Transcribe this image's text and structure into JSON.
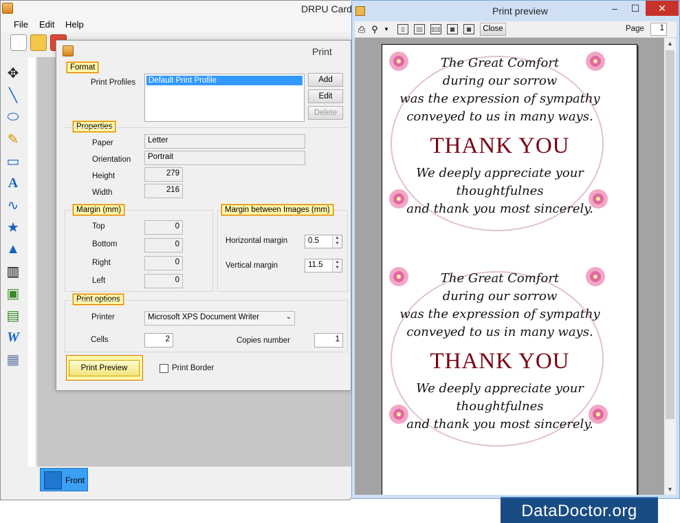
{
  "app": {
    "title": "DRPU Card",
    "menu": [
      "File",
      "Edit",
      "Help"
    ],
    "bottom_tab": "Front"
  },
  "print_dialog": {
    "title": "Print",
    "format_label": "Format",
    "profiles_label": "Print Profiles",
    "profiles": [
      "Default Print Profile"
    ],
    "add_label": "Add",
    "edit_label": "Edit",
    "delete_label": "Delete",
    "properties_label": "Properties",
    "paper_label": "Paper",
    "paper_value": "Letter",
    "orientation_label": "Orientation",
    "orientation_value": "Portrait",
    "height_label": "Height",
    "height_value": "279",
    "width_label": "Width",
    "width_value": "216",
    "margin_label": "Margin (mm)",
    "top_label": "Top",
    "top_value": "0",
    "bottom_label": "Bottom",
    "bottom_value": "0",
    "right_label": "Right",
    "right_value": "0",
    "left_label": "Left",
    "left_value": "0",
    "margin_images_label": "Margin between Images (mm)",
    "hmargin_label": "Horizontal margin",
    "hmargin_value": "0.5",
    "vmargin_label": "Vertical margin",
    "vmargin_value": "11.5",
    "print_options_label": "Print options",
    "printer_label": "Printer",
    "printer_value": "Microsoft XPS Document Writer",
    "cells_label": "Cells",
    "cells_value": "2",
    "copies_label": "Copies number",
    "copies_value": "1",
    "preview_button": "Print Preview",
    "border_label": "Print Border",
    "border_checked": false
  },
  "preview": {
    "title": "Print preview",
    "close_label": "Close",
    "page_label": "Page",
    "page_value": "1",
    "card": {
      "line1": "The Great Comfort",
      "line2": "during our sorrow",
      "line3": "was the expression of sympathy",
      "line4": "conveyed to us in many ways.",
      "thank": "THANK YOU",
      "line5": "We deeply appreciate your",
      "line6": "thoughtfulnes",
      "line7": "and thank you most sincerely."
    }
  },
  "watermark": "DataDoctor.org",
  "colors": {
    "highlight": "#fff7a8",
    "highlight_border": "#e07000",
    "thank_you": "#7a0010",
    "logo_bg": "#1a4c84",
    "preview_frame": "#cfe0f5"
  }
}
